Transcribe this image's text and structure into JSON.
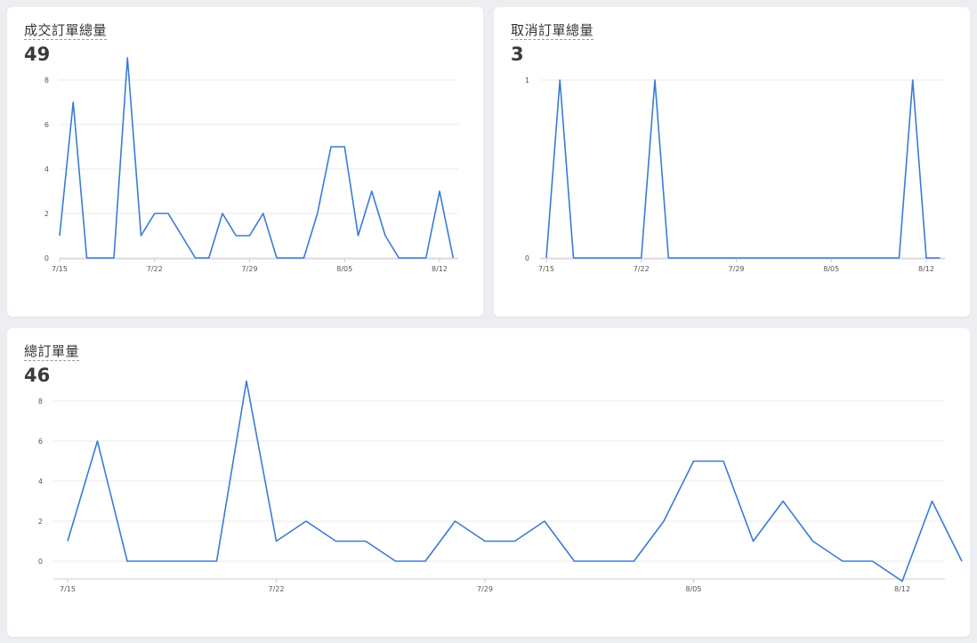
{
  "cards": [
    {
      "title": "成交訂單總量",
      "value": "49",
      "chart_data": {
        "type": "line",
        "x_labels": [
          "7/15",
          "7/22",
          "7/29",
          "8/05",
          "8/12"
        ],
        "y_ticks": [
          "0",
          "2",
          "4",
          "6",
          "8"
        ],
        "ylim": [
          0,
          8
        ],
        "grid": true,
        "series": [
          {
            "values": [
              1,
              7,
              0,
              0,
              0,
              9,
              1,
              2,
              2,
              1,
              0,
              0,
              2,
              1,
              1,
              2,
              0,
              0,
              0,
              2,
              5,
              5,
              1,
              3,
              1,
              0,
              0,
              0,
              3,
              0
            ],
            "color": "#3a7bd5"
          }
        ]
      }
    },
    {
      "title": "取消訂單總量",
      "value": "3",
      "chart_data": {
        "type": "line",
        "x_labels": [
          "7/15",
          "7/22",
          "7/29",
          "8/05",
          "8/12"
        ],
        "y_ticks": [
          "0",
          "1"
        ],
        "ylim": [
          0,
          1
        ],
        "grid": true,
        "series": [
          {
            "values": [
              0,
              1,
              0,
              0,
              0,
              0,
              0,
              0,
              1,
              0,
              0,
              0,
              0,
              0,
              0,
              0,
              0,
              0,
              0,
              0,
              0,
              0,
              0,
              0,
              0,
              0,
              0,
              1,
              0,
              0
            ],
            "color": "#3a7bd5"
          }
        ]
      }
    },
    {
      "title": "總訂單量",
      "value": "46",
      "chart_data": {
        "type": "line",
        "x_labels": [
          "7/15",
          "7/22",
          "7/29",
          "8/05",
          "8/12"
        ],
        "y_ticks": [
          "0",
          "2",
          "4",
          "6",
          "8"
        ],
        "ylim": [
          0,
          8
        ],
        "grid": true,
        "series": [
          {
            "values": [
              1,
              6,
              0,
              0,
              0,
              0,
              9,
              1,
              2,
              1,
              1,
              0,
              0,
              2,
              1,
              1,
              2,
              0,
              0,
              0,
              2,
              5,
              5,
              1,
              3,
              1,
              0,
              0,
              -1,
              3,
              0
            ],
            "color": "#3a7bd5"
          }
        ]
      }
    }
  ],
  "style": {
    "line_color": "#3a7bd5",
    "grid_color": "#e8e8e8",
    "axis_color": "#cccccc"
  }
}
